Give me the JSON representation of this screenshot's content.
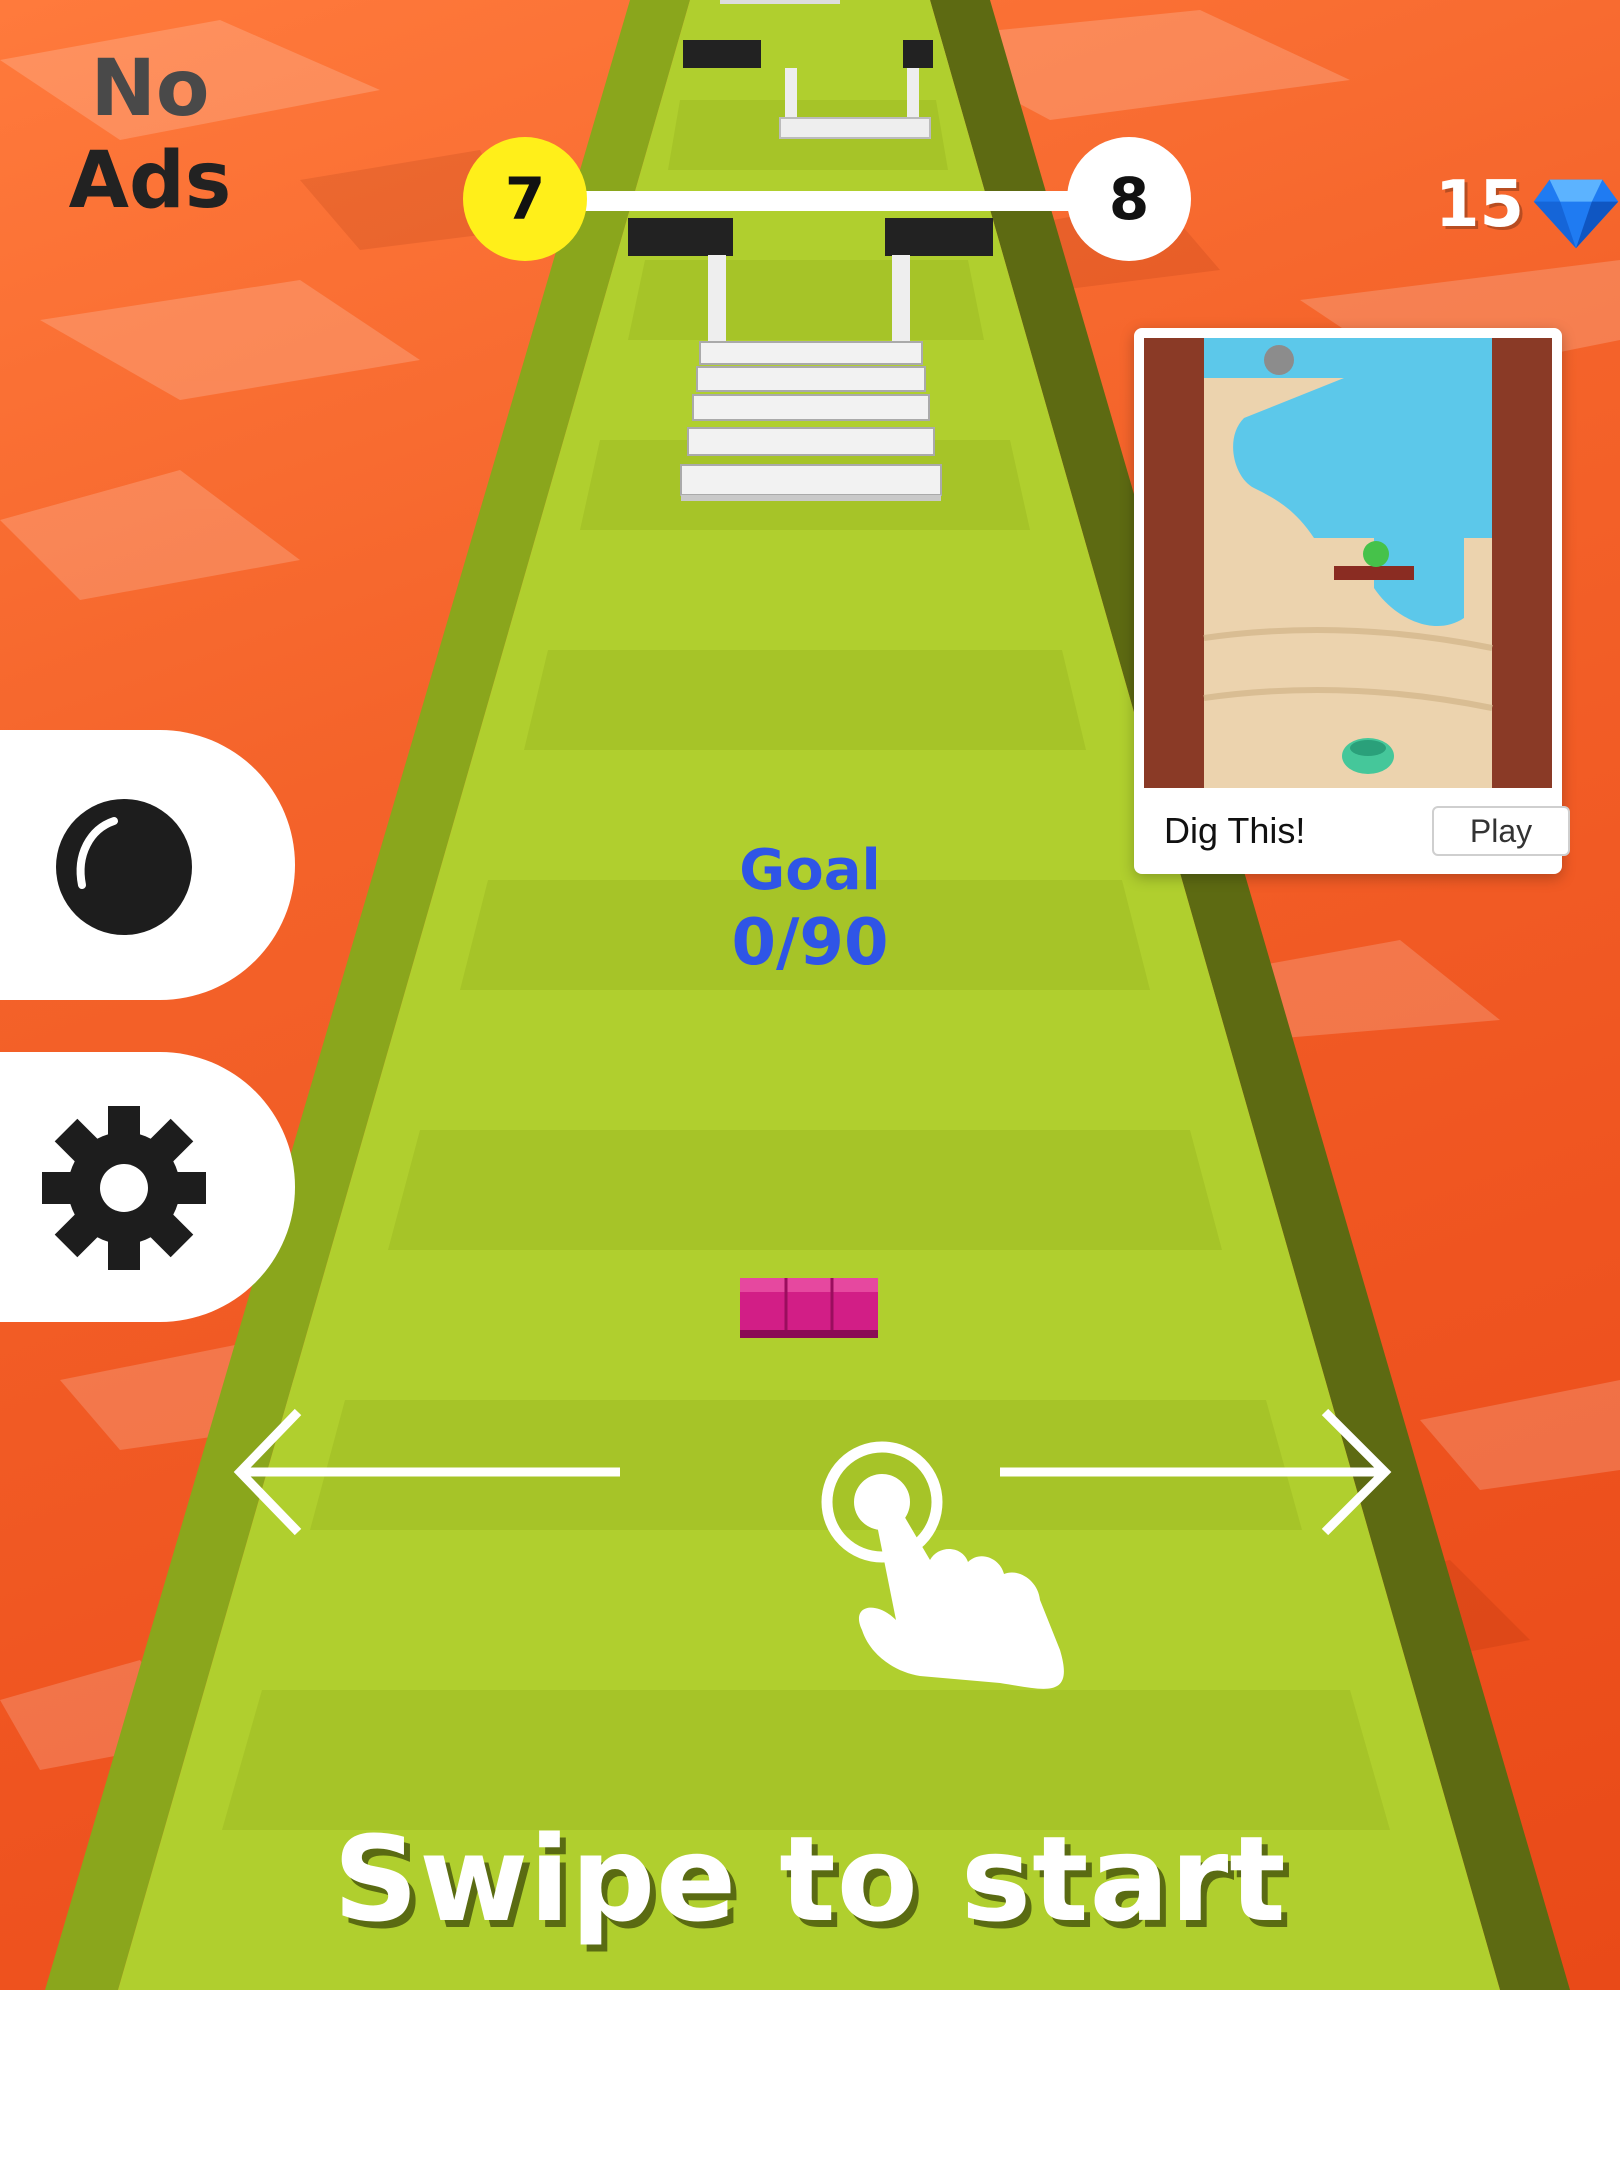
{
  "hud": {
    "level_current": "7",
    "level_next": "8",
    "gems": "15",
    "gem_icon": "diamond-icon"
  },
  "side_buttons": {
    "skin_icon": "ball-icon",
    "settings_icon": "gear-icon",
    "no_ads_line1": "No",
    "no_ads_line2": "Ads"
  },
  "ad": {
    "title": "Dig This!",
    "play_label": "Play"
  },
  "goal": {
    "label": "Goal",
    "progress": "0/90"
  },
  "tutorial": {
    "hand_icon": "tap-hand-icon",
    "arrow_left_icon": "arrow-left-icon",
    "arrow_right_icon": "arrow-right-icon",
    "instruction": "Swipe to start"
  },
  "colors": {
    "lava": "#f25a22",
    "track": "#b0cf2e",
    "level_current_bg": "#ffef1a",
    "goal_text": "#2f55e6",
    "player_blocks": "#d21e86"
  }
}
